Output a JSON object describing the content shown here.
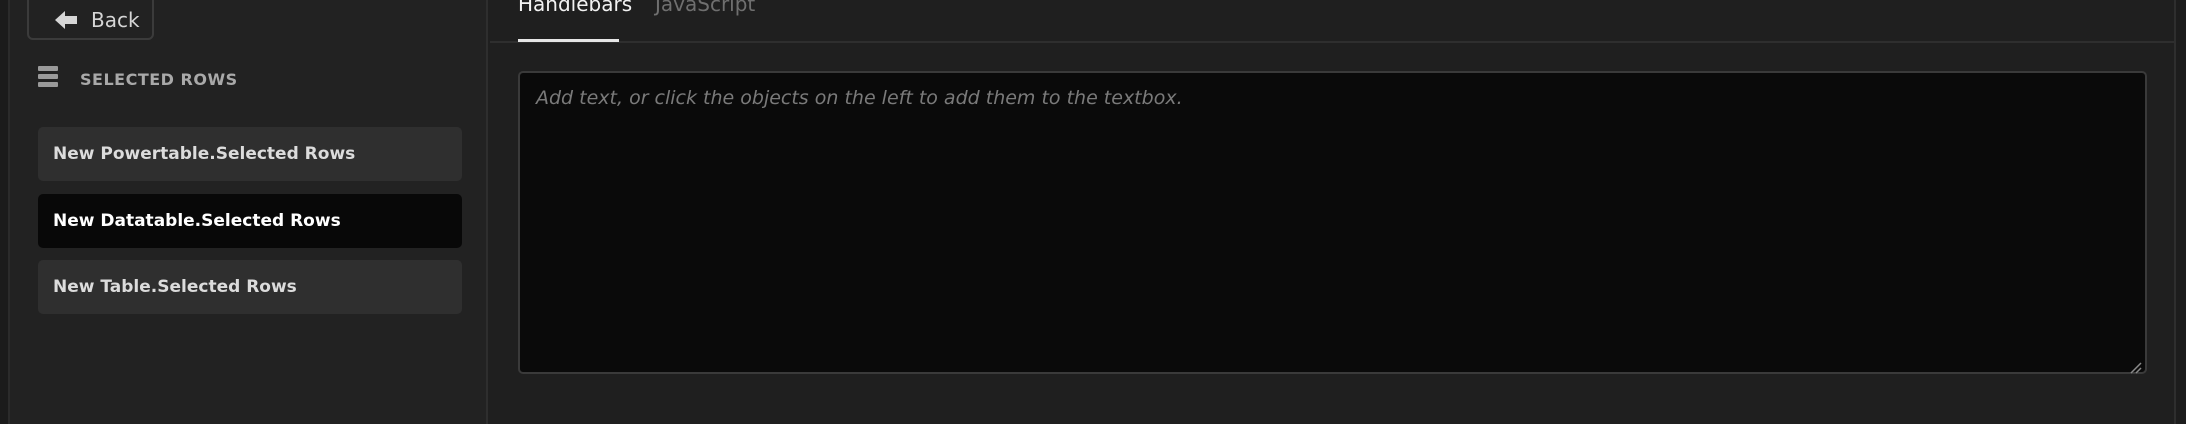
{
  "back_button": {
    "label": "Back",
    "icon": "arrow-left-icon"
  },
  "section": {
    "title": "SELECTED ROWS",
    "icon": "stack-icon"
  },
  "rows": [
    {
      "label": "New Powertable.Selected Rows",
      "selected": false
    },
    {
      "label": "New Datatable.Selected Rows",
      "selected": true
    },
    {
      "label": "New Table.Selected Rows",
      "selected": false
    }
  ],
  "tabs": [
    {
      "label": "Handlebars",
      "active": true
    },
    {
      "label": "JavaScript",
      "active": false
    }
  ],
  "editor": {
    "value": "",
    "placeholder": "Add text, or click the objects on the left to add them to the textbox."
  },
  "colors": {
    "background": "#1f1f1f",
    "row_background": "#2f2f2f",
    "row_selected_background": "#080808",
    "editor_background": "#0a0a0a"
  }
}
